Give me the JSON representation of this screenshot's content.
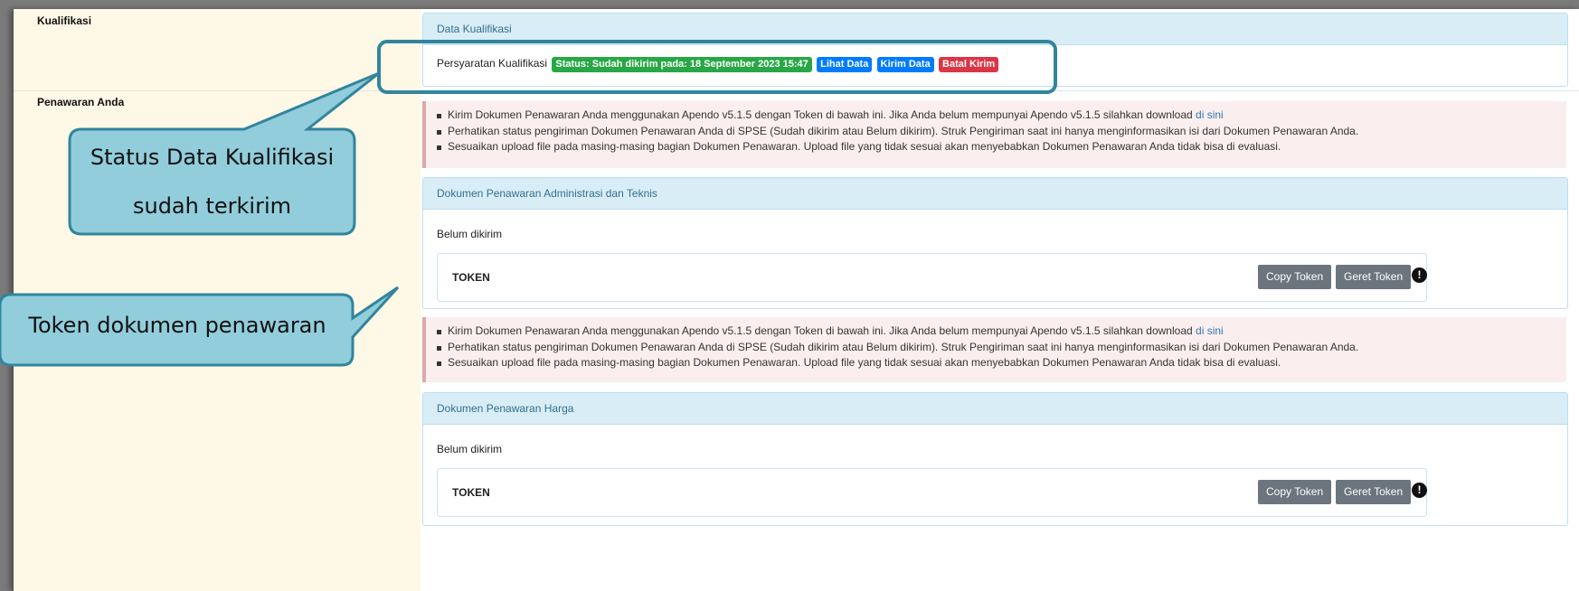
{
  "rows": {
    "kualifikasi_label": "Kualifikasi",
    "penawaran_label": "Penawaran Anda"
  },
  "kualifikasi_panel": {
    "title": "Data Kualifikasi",
    "item_label": "Persyaratan Kualifikasi",
    "status_badge": "Status: Sudah dikirim pada: 18 September 2023 15:47",
    "lihat_data": "Lihat Data",
    "kirim_data": "Kirim Data",
    "batal_kirim": "Batal Kirim"
  },
  "notice": {
    "line1": "Kirim Dokumen Penawaran Anda menggunakan Apendo v5.1.5 dengan Token di bawah ini. Jika Anda belum mempunyai Apendo v5.1.5 silahkan download",
    "link": "di sini",
    "line2": "Perhatikan status pengiriman Dokumen Penawaran Anda di SPSE (Sudah dikirim atau Belum dikirim). Struk Pengiriman saat ini hanya menginformasikan isi dari Dokumen Penawaran Anda.",
    "line3": "Sesuaikan upload file pada masing-masing bagian Dokumen Penawaran. Upload file yang tidak sesuai akan menyebabkan Dokumen Penawaran Anda tidak bisa di evaluasi."
  },
  "admin_panel": {
    "title": "Dokumen Penawaran Administrasi dan Teknis",
    "status": "Belum dikirim",
    "token_label": "TOKEN",
    "copy_token": "Copy Token",
    "geret_token": "Geret Token"
  },
  "harga_panel": {
    "title": "Dokumen Penawaran Harga",
    "status": "Belum dikirim",
    "token_label": "TOKEN",
    "copy_token": "Copy Token",
    "geret_token": "Geret Token"
  },
  "callouts": {
    "status_line1": "Status Data Kualifikasi",
    "status_line2": "sudah terkirim",
    "token": "Token dokumen penawaran"
  },
  "colors": {
    "badge_success": "#28a745",
    "badge_primary": "#007bff",
    "badge_danger": "#dc3545",
    "callout_fill": "#92cddc",
    "callout_border": "#31859c",
    "left_column": "#fef8e6",
    "panel_header": "#d9edf7"
  },
  "icons": {
    "warning": "exclamation-circle-icon",
    "bullet": "square-bullet-icon"
  }
}
